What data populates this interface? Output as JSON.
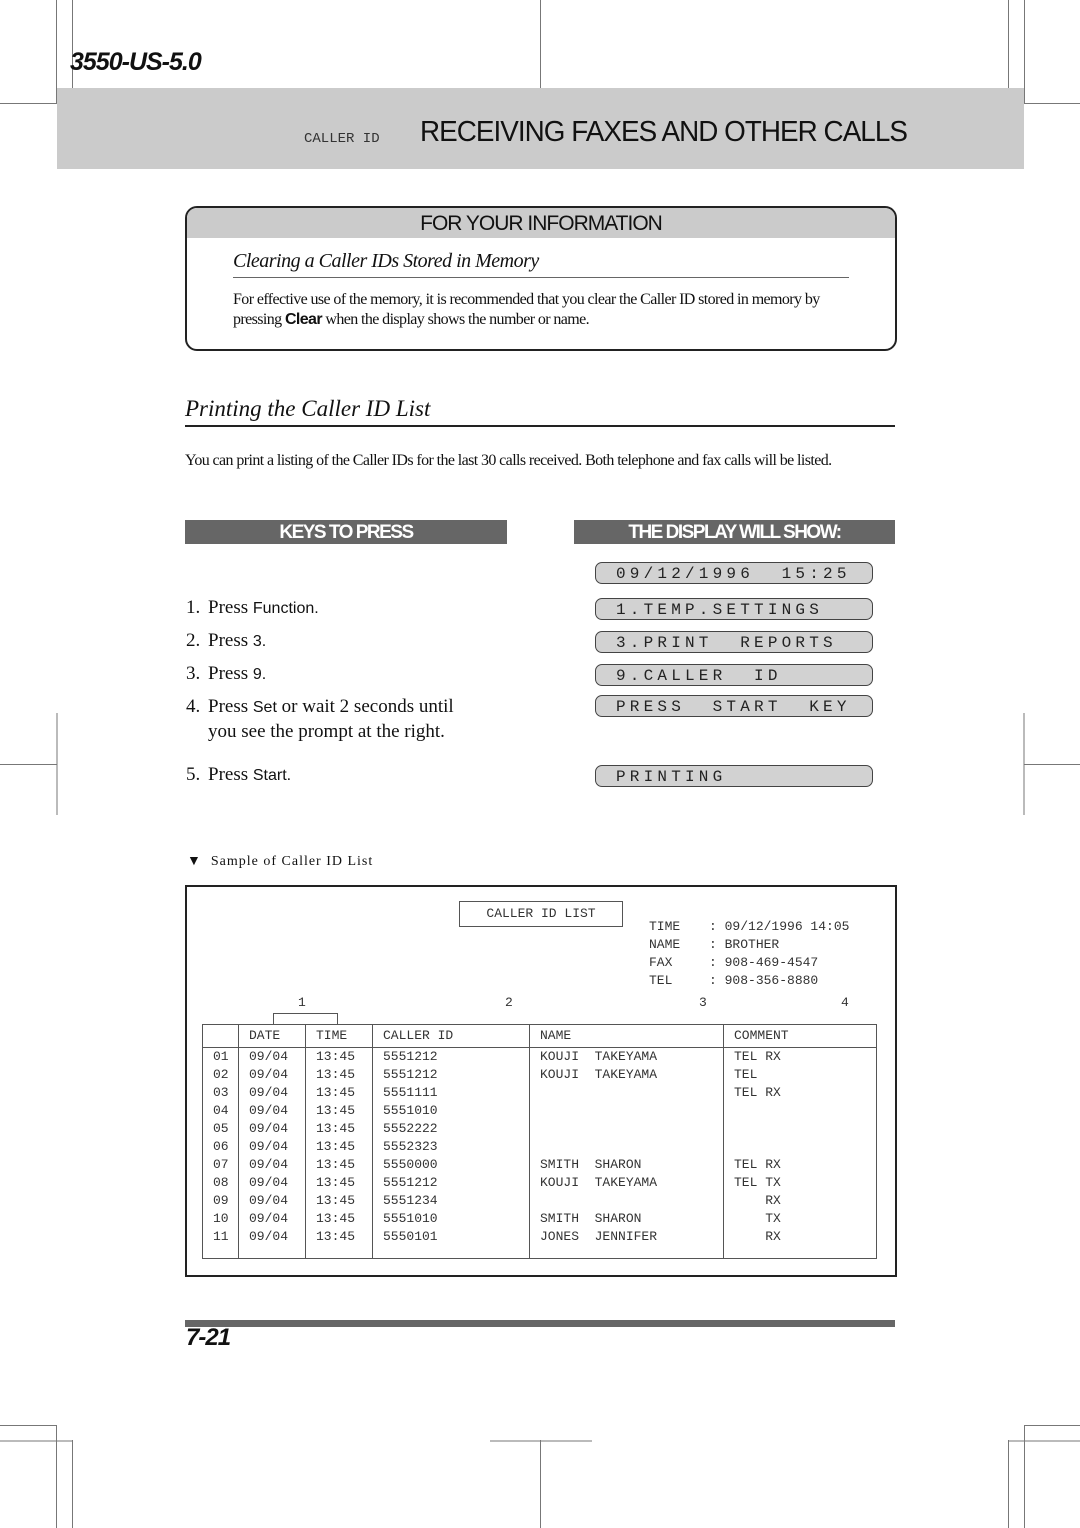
{
  "header": {
    "model": "3550-US-5.0",
    "section_small": "CALLER ID",
    "section_title": "RECEIVING FAXES AND OTHER CALLS"
  },
  "info_box": {
    "heading": "FOR YOUR INFORMATION",
    "subtitle": "Clearing a Caller IDs Stored in Memory",
    "body_before": "For effective use of the memory, it is recommended that you clear the Caller ID stored in memory by pressing ",
    "body_key": "Clear",
    "body_after": " when the display shows the number or name."
  },
  "section": {
    "title": "Printing the Caller ID List",
    "intro": "You can print a listing of the Caller IDs for the last 30 calls received. Both telephone and fax calls will be listed."
  },
  "keys_header": "KEYS TO PRESS",
  "display_header": "THE DISPLAY WILL SHOW:",
  "steps": [
    {
      "num": "1.",
      "text": "Press ",
      "key": "Function",
      "after": "."
    },
    {
      "num": "2.",
      "text": "Press ",
      "key": "3",
      "after": "."
    },
    {
      "num": "3.",
      "text": "Press ",
      "key": "9",
      "after": "."
    },
    {
      "num": "4.",
      "text": "Press ",
      "key": "Set",
      "after": " or wait 2 seconds until",
      "line2": "you see the prompt at the right."
    },
    {
      "num": "5.",
      "text": "Press ",
      "key": "Start",
      "after": "."
    }
  ],
  "display": [
    "09/12/1996  15:25",
    "1.TEMP.SETTINGS",
    "3.PRINT  REPORTS",
    "9.CALLER  ID",
    "PRESS  START  KEY",
    "PRINTING"
  ],
  "sample": {
    "caption": "Sample of Caller ID List",
    "caption_icon": "▼",
    "list_title": "CALLER ID LIST",
    "header_fields": [
      {
        "label": "TIME",
        "value": "09/12/1996 14:05"
      },
      {
        "label": "NAME",
        "value": "BROTHER"
      },
      {
        "label": "FAX",
        "value": "908-469-4547"
      },
      {
        "label": "TEL",
        "value": "908-356-8880"
      }
    ],
    "column_numbers": [
      "1",
      "2",
      "3",
      "4"
    ],
    "columns": [
      "",
      "DATE",
      "TIME",
      "CALLER ID",
      "NAME",
      "COMMENT"
    ],
    "rows": [
      [
        "01",
        "09/04",
        "13:45",
        "5551212",
        "KOUJI  TAKEYAMA",
        "TEL RX"
      ],
      [
        "02",
        "09/04",
        "13:45",
        "5551212",
        "KOUJI  TAKEYAMA",
        "TEL"
      ],
      [
        "03",
        "09/04",
        "13:45",
        "5551111",
        "",
        "TEL RX"
      ],
      [
        "04",
        "09/04",
        "13:45",
        "5551010",
        "",
        ""
      ],
      [
        "05",
        "09/04",
        "13:45",
        "5552222",
        "",
        ""
      ],
      [
        "06",
        "09/04",
        "13:45",
        "5552323",
        "",
        ""
      ],
      [
        "07",
        "09/04",
        "13:45",
        "5550000",
        "SMITH  SHARON",
        "TEL RX"
      ],
      [
        "08",
        "09/04",
        "13:45",
        "5551212",
        "KOUJI  TAKEYAMA",
        "TEL TX"
      ],
      [
        "09",
        "09/04",
        "13:45",
        "5551234",
        "",
        "    RX"
      ],
      [
        "10",
        "09/04",
        "13:45",
        "5551010",
        "SMITH  SHARON",
        "    TX"
      ],
      [
        "11",
        "09/04",
        "13:45",
        "5550101",
        "JONES  JENNIFER",
        "    RX"
      ]
    ]
  },
  "footer": {
    "page_number": "7-21"
  }
}
